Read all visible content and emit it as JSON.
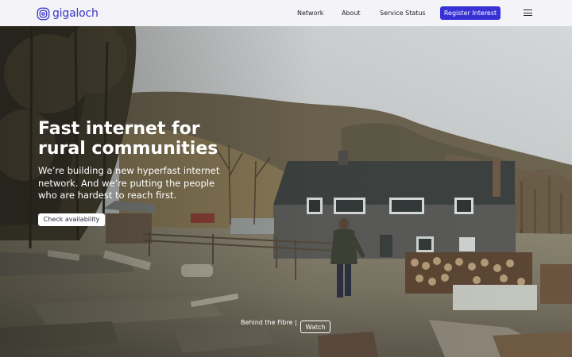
{
  "brand": {
    "name": "gigaloch",
    "icon": "concentric-rounded-square-icon",
    "color": "#3b35c9"
  },
  "nav": {
    "items": [
      {
        "label": "Network"
      },
      {
        "label": "About"
      },
      {
        "label": "Service Status"
      }
    ],
    "cta_label": "Register Interest",
    "cta_color": "#3731d6",
    "menu_icon": "hamburger-menu-icon"
  },
  "hero": {
    "headline": [
      "Fast internet for",
      "rural communities"
    ],
    "subtitle": [
      "We’re building a new hyperfast internet",
      "network. And we’re putting the people",
      "who are hardest to reach first."
    ],
    "check_label": "Check availability",
    "video_label": "Behind the Fibre",
    "video_separator": "|",
    "watch_label": "Watch"
  }
}
